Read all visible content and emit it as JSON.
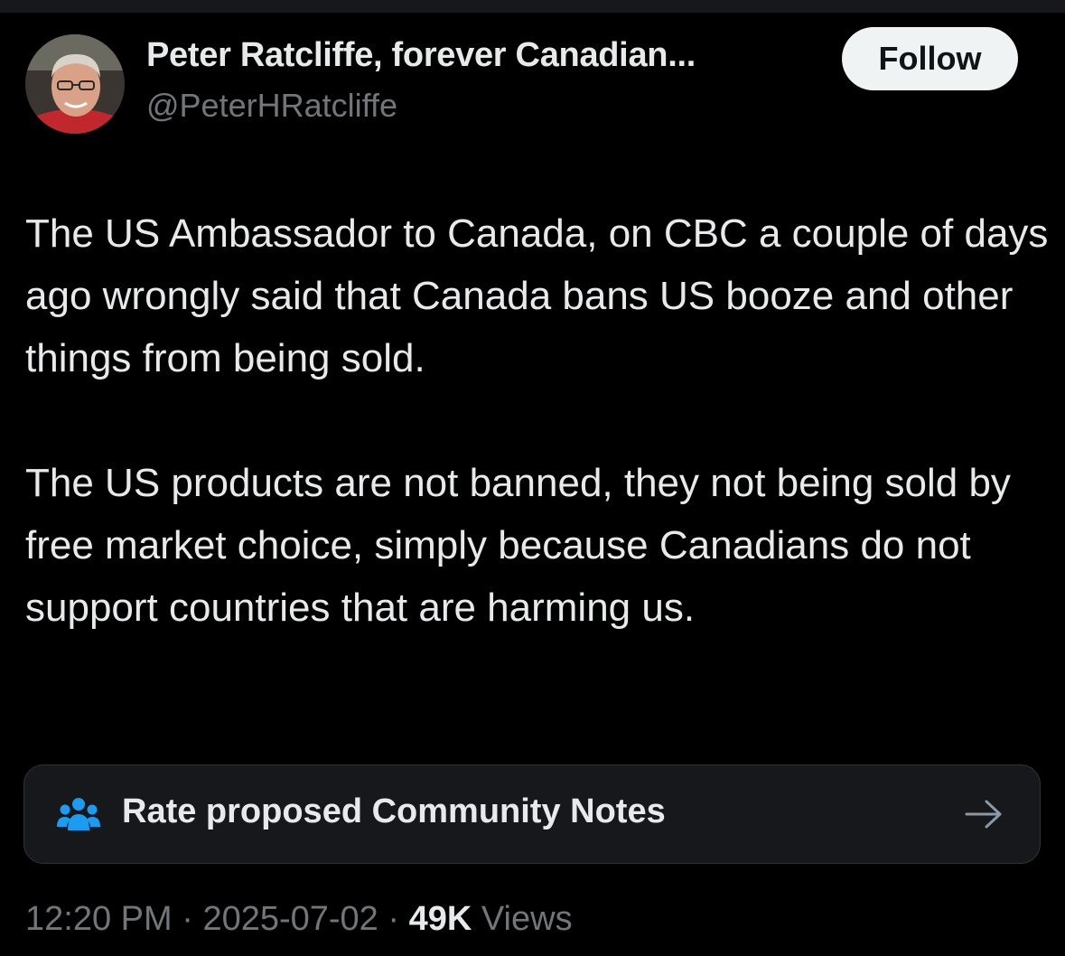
{
  "author": {
    "display_name": "Peter Ratcliffe, forever Canadian...",
    "handle": "@PeterHRatcliffe"
  },
  "follow_button": {
    "label": "Follow"
  },
  "tweet": {
    "paragraphs": [
      "The US Ambassador to Canada, on CBC a couple of days ago wrongly said that Canada bans US booze and other things from being sold.",
      "The US products are not banned,  they not being sold by free market choice, simply because Canadians do not support countries that are harming us."
    ]
  },
  "community_notes": {
    "label": "Rate proposed Community Notes",
    "icon": "people-group-icon",
    "arrow_icon": "arrow-right-icon"
  },
  "meta": {
    "time": "12:20 PM",
    "separator": "·",
    "date": "2025-07-02",
    "views_count": "49K",
    "views_label": "Views"
  },
  "colors": {
    "background": "#000000",
    "text_primary": "#e7e9ea",
    "text_secondary": "#71767b",
    "follow_bg": "#eff3f4",
    "notes_icon": "#1d9bf0",
    "card_bg": "#16181c"
  }
}
